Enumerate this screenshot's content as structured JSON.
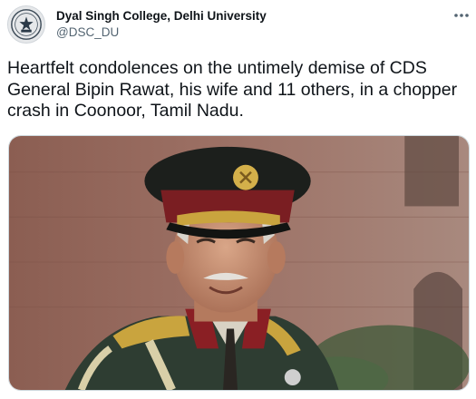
{
  "tweet": {
    "author_name": "Dyal Singh College, Delhi University",
    "author_handle": "@DSC_DU",
    "text": "Heartfelt condolences on the untimely demise of CDS General Bipin Rawat, his wife and 11 others, in a chopper crash in Coonoor, Tamil Nadu.",
    "avatar_icon": "college-crest-icon",
    "more_icon": "more-options-icon",
    "media_icon": "photo-of-general-in-uniform"
  },
  "colors": {
    "text_primary": "#0f1419",
    "text_secondary": "#536471",
    "border": "#cfd9de"
  }
}
